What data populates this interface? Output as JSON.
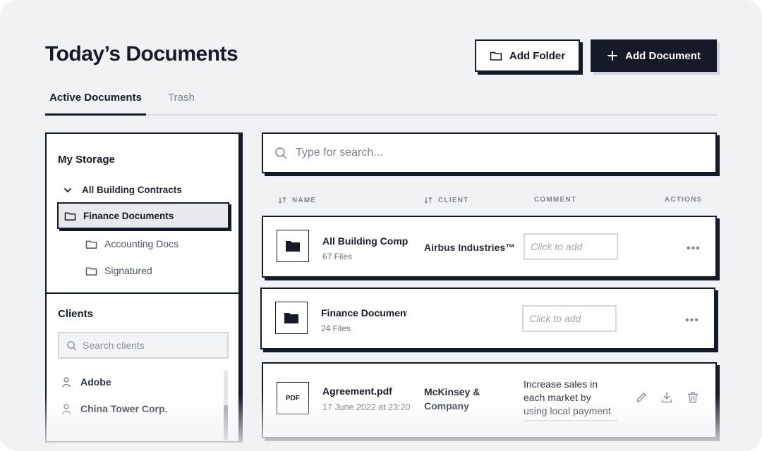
{
  "header": {
    "title": "Today’s Documents",
    "add_folder_label": "Add Folder",
    "add_document_label": "Add Document"
  },
  "tabs": [
    {
      "label": "Active Documents",
      "active": true
    },
    {
      "label": "Trash",
      "active": false
    }
  ],
  "sidebar": {
    "storage_title": "My Storage",
    "tree": {
      "root": "All Building Contracts",
      "selected": "Finance Documents",
      "children": [
        "Accounting Docs",
        "Signatured"
      ]
    },
    "clients_title": "Clients",
    "client_search_placeholder": "Search clients",
    "clients": [
      "Adobe",
      "China Tower Corp."
    ]
  },
  "main": {
    "search_placeholder": "Type for search...",
    "columns": {
      "name": "NAME",
      "client": "CLIENT",
      "comment": "COMMENT",
      "actions": "ACTIONS"
    },
    "rows": [
      {
        "type": "folder",
        "name": "All Building Compa",
        "sub": "67 Files",
        "client": "Airbus Industries™",
        "comment_placeholder": "Click to add",
        "actions": "•••"
      },
      {
        "type": "folder",
        "name": "Finance Document",
        "sub": "24 Files",
        "client": "",
        "comment_placeholder": "Click to add",
        "actions": "•••"
      },
      {
        "type": "file",
        "file_label": "PDF",
        "name": "Agreement.pdf",
        "sub": "17 June 2022 at 23:20",
        "client_line1": "McKinsey &",
        "client_line2": "Company",
        "comment_line1": "Increase sales in",
        "comment_line2": "each market by",
        "comment_line3": "using local payment"
      }
    ]
  },
  "colors": {
    "ink": "#141a27",
    "background": "#f1f2f4",
    "muted": "#7d8391"
  }
}
